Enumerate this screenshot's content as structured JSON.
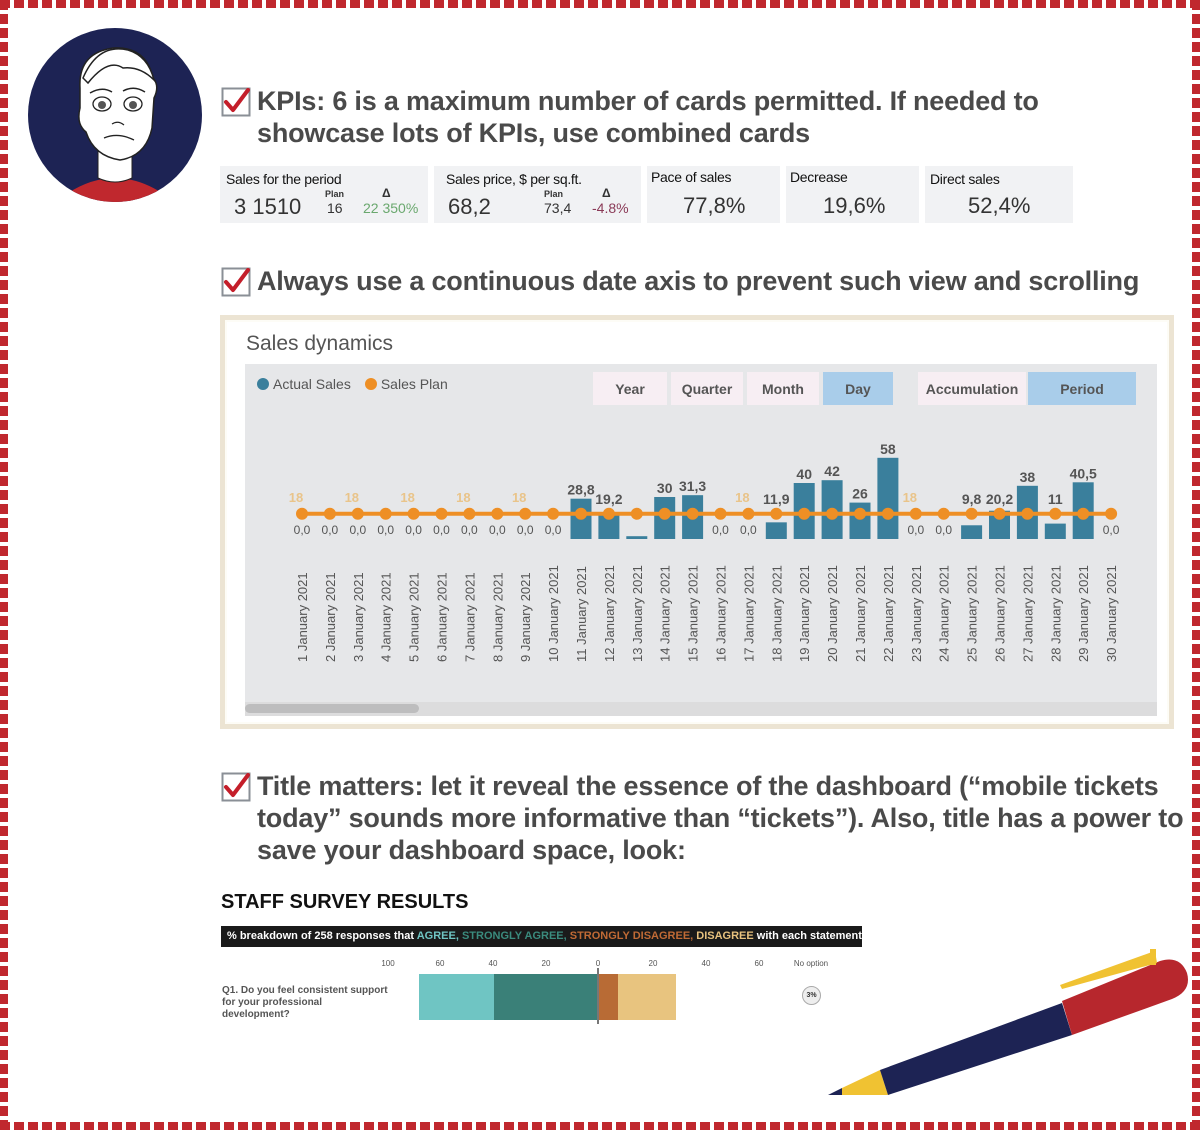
{
  "tips": [
    {
      "text_line1": "KPIs: 6 is a maximum number of cards permitted. If needed to",
      "text_line2": "showcase lots of KPIs, use combined cards"
    },
    {
      "text_line1": "Always use a continuous date axis to prevent such view and scrolling"
    },
    {
      "text_line1": "Title matters: let it reveal the essence of the dashboard (“mobile tickets",
      "text_line2": "today” sounds more informative than “tickets”). Also, title has a power to",
      "text_line3": "save your dashboard space, look:"
    }
  ],
  "kpi_cards": [
    {
      "title": "Sales for the period",
      "value": "3 1510",
      "plan_label": "Plan",
      "plan_value": "16",
      "delta_label": "Δ",
      "delta_value": "22 350%"
    },
    {
      "title": "Sales price, $ per sq.ft.",
      "value": "68,2",
      "plan_label": "Plan",
      "plan_value": "73,4",
      "delta_label": "Δ",
      "delta_value": "-4.8%"
    },
    {
      "title": "Pace of sales",
      "value": "77,8%"
    },
    {
      "title": "Decrease",
      "value": "19,6%"
    },
    {
      "title": "Direct sales",
      "value": "52,4%"
    }
  ],
  "sales_widget": {
    "title": "Sales dynamics",
    "legend": [
      {
        "label": "Actual Sales",
        "color": "#3a7f9c"
      },
      {
        "label": "Sales Plan",
        "color": "#ee8f25"
      }
    ],
    "granularity_buttons": [
      {
        "label": "Year",
        "active": false
      },
      {
        "label": "Quarter",
        "active": false
      },
      {
        "label": "Month",
        "active": false
      },
      {
        "label": "Day",
        "active": true
      }
    ],
    "mode_buttons": [
      {
        "label": "Accumulation",
        "active": false
      },
      {
        "label": "Period",
        "active": true
      }
    ]
  },
  "chart_data": {
    "type": "bar",
    "title": "Sales dynamics",
    "xlabel": "",
    "ylabel": "",
    "categories": [
      "1 January 2021",
      "2 January 2021",
      "3 January 2021",
      "4 January 2021",
      "5 January 2021",
      "6 January 2021",
      "7 January 2021",
      "8 January 2021",
      "9 January 2021",
      "10 January 2021",
      "11 January 2021",
      "12 January 2021",
      "13 January 2021",
      "14 January 2021",
      "15 January 2021",
      "16 January 2021",
      "17 January 2021",
      "18 January 2021",
      "19 January 2021",
      "20 January 2021",
      "21 January 2021",
      "22 January 2021",
      "23 January 2021",
      "24 January 2021",
      "25 January 2021",
      "26 January 2021",
      "27 January 2021",
      "28 January 2021",
      "29 January 2021",
      "30 January 2021"
    ],
    "series": [
      {
        "name": "Actual Sales",
        "type": "bar",
        "color": "#3a7f9c",
        "values": [
          0,
          0,
          0,
          0,
          0,
          0,
          0,
          0,
          0,
          0,
          28.8,
          19.2,
          2,
          30,
          31.3,
          0,
          0,
          11.9,
          40,
          42,
          26,
          58,
          0,
          0,
          9.8,
          20.2,
          38,
          11,
          40.5,
          0
        ],
        "labels": [
          "0,0",
          "0,0",
          "0,0",
          "0,0",
          "0,0",
          "0,0",
          "0,0",
          "0,0",
          "0,0",
          "0,0",
          "28,8",
          "19,2",
          "",
          "30",
          "31,3",
          "0,0",
          "0,0",
          "11,9",
          "40",
          "42",
          "26",
          "58",
          "0,0",
          "0,0",
          "9,8",
          "20,2",
          "38",
          "11",
          "40,5",
          "0,0"
        ]
      },
      {
        "name": "Sales Plan",
        "type": "line",
        "color": "#ee8f25",
        "values": [
          18,
          18,
          18,
          18,
          18,
          18,
          18,
          18,
          18,
          18,
          18,
          18,
          18,
          18,
          18,
          18,
          18,
          18,
          18,
          18,
          18,
          18,
          18,
          18,
          18,
          18,
          18,
          18,
          18,
          18
        ],
        "label_text": "18",
        "labeled_indices": [
          0,
          2,
          4,
          6,
          8,
          16,
          22
        ]
      }
    ],
    "ylim": [
      0,
      60
    ],
    "grid": false,
    "legend_position": "top-left"
  },
  "survey": {
    "title": "STAFF SURVEY RESULTS",
    "banner_prefix": "% breakdown of 258 responses that ",
    "banner_agree": "AGREE,",
    "banner_strongly_agree": " STRONGLY AGREE,",
    "banner_strongly_disagree": " STRONGLY DISAGREE,",
    "banner_disagree": " DISAGREE",
    "banner_suffix": " with each statement",
    "axis_ticks": [
      "100",
      "60",
      "40",
      "20",
      "0",
      "20",
      "40",
      "60"
    ],
    "no_option_label": "No option",
    "question": "Q1. Do you feel consistent support for your professional development?",
    "no_option_value": "3%",
    "segments": [
      {
        "name": "Agree",
        "value": 28,
        "color": "#6fc5c3"
      },
      {
        "name": "Strongly agree",
        "value": 39,
        "color": "#3a8078"
      },
      {
        "name": "Strongly disagree",
        "value": 8,
        "color": "#b86b35"
      },
      {
        "name": "Disagree",
        "value": 22,
        "color": "#e8c47f"
      }
    ]
  }
}
